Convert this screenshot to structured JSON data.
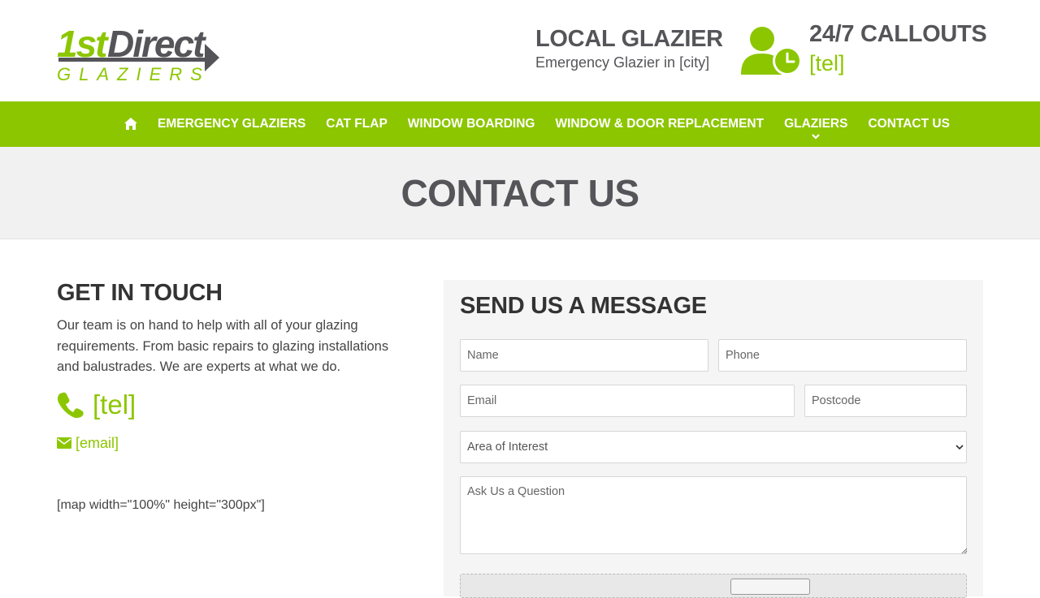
{
  "header": {
    "logo": {
      "word1": "1st",
      "word2": "Direct",
      "word3": "GLAZIERS"
    },
    "local_title": "LOCAL GLAZIER",
    "local_sub": "Emergency Glazier in [city]",
    "callouts_title": "24/7 CALLOUTS",
    "callouts_tel": "[tel]"
  },
  "nav": {
    "items": [
      {
        "label": "EMERGENCY GLAZIERS"
      },
      {
        "label": "CAT FLAP"
      },
      {
        "label": "WINDOW BOARDING"
      },
      {
        "label": "WINDOW & DOOR REPLACEMENT"
      },
      {
        "label": "GLAZIERS"
      },
      {
        "label": "CONTACT US"
      }
    ]
  },
  "banner": {
    "title": "CONTACT US"
  },
  "get_in_touch": {
    "title": "GET IN TOUCH",
    "body": "Our team is on hand to help with all of your glazing requirements. From basic repairs to glazing installations and balustrades. We are experts at what we do.",
    "tel": "[tel]",
    "email": "[email]",
    "map_shortcode": "[map width=\"100%\" height=\"300px\"]"
  },
  "form": {
    "title": "SEND US A MESSAGE",
    "name_placeholder": "Name",
    "phone_placeholder": "Phone",
    "email_placeholder": "Email",
    "postcode_placeholder": "Postcode",
    "interest_selected": "Area of Interest",
    "question_placeholder": "Ask Us a Question"
  },
  "colors": {
    "brand_green": "#8cc600",
    "brand_grey": "#555559"
  },
  "icons": {
    "nav_home": "home-icon",
    "callout": "user-clock-icon",
    "phone": "phone-icon",
    "email": "envelope-icon"
  }
}
